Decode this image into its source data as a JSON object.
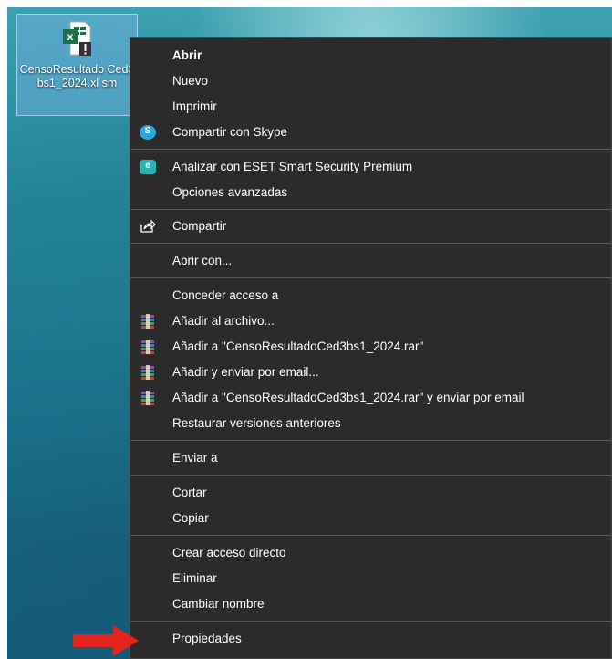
{
  "desktop": {
    "file": {
      "name": "CensoResultadoCed3bs1_2024.xlsm",
      "name_display": "CensoResultado Ced3bs1_2024.xl sm",
      "icon": "excel-macro-warning-icon"
    }
  },
  "menu": {
    "items": [
      {
        "id": "open",
        "label": "Abrir"
      },
      {
        "id": "new",
        "label": "Nuevo"
      },
      {
        "id": "print",
        "label": "Imprimir"
      },
      {
        "id": "share-skype",
        "label": "Compartir con Skype",
        "icon": "skype-icon"
      },
      {
        "id": "eset-scan",
        "label": "Analizar con ESET Smart Security Premium",
        "icon": "eset-icon"
      },
      {
        "id": "advanced-options",
        "label": "Opciones avanzadas"
      },
      {
        "id": "share",
        "label": "Compartir",
        "icon": "share-icon"
      },
      {
        "id": "open-with",
        "label": "Abrir con..."
      },
      {
        "id": "grant-access",
        "label": "Conceder acceso a"
      },
      {
        "id": "add-archive",
        "label": "Añadir al archivo...",
        "icon": "winrar-icon"
      },
      {
        "id": "add-to-rar",
        "label": "Añadir a \"CensoResultadoCed3bs1_2024.rar\"",
        "icon": "winrar-icon"
      },
      {
        "id": "add-email",
        "label": "Añadir y enviar por email...",
        "icon": "winrar-icon"
      },
      {
        "id": "add-rar-email",
        "label": "Añadir a \"CensoResultadoCed3bs1_2024.rar\" y enviar por email",
        "icon": "winrar-icon"
      },
      {
        "id": "restore-versions",
        "label": "Restaurar versiones anteriores"
      },
      {
        "id": "send-to",
        "label": "Enviar a"
      },
      {
        "id": "cut",
        "label": "Cortar"
      },
      {
        "id": "copy",
        "label": "Copiar"
      },
      {
        "id": "create-shortcut",
        "label": "Crear acceso directo"
      },
      {
        "id": "delete",
        "label": "Eliminar"
      },
      {
        "id": "rename",
        "label": "Cambiar nombre"
      },
      {
        "id": "properties",
        "label": "Propiedades"
      }
    ]
  },
  "annotation": {
    "icon": "red-arrow-icon",
    "color": "#e3231c"
  },
  "colors": {
    "menu_bg": "#2b2b2b",
    "separator": "#5a5a5a",
    "text": "#ffffff",
    "selection": "#7ab8ea"
  }
}
